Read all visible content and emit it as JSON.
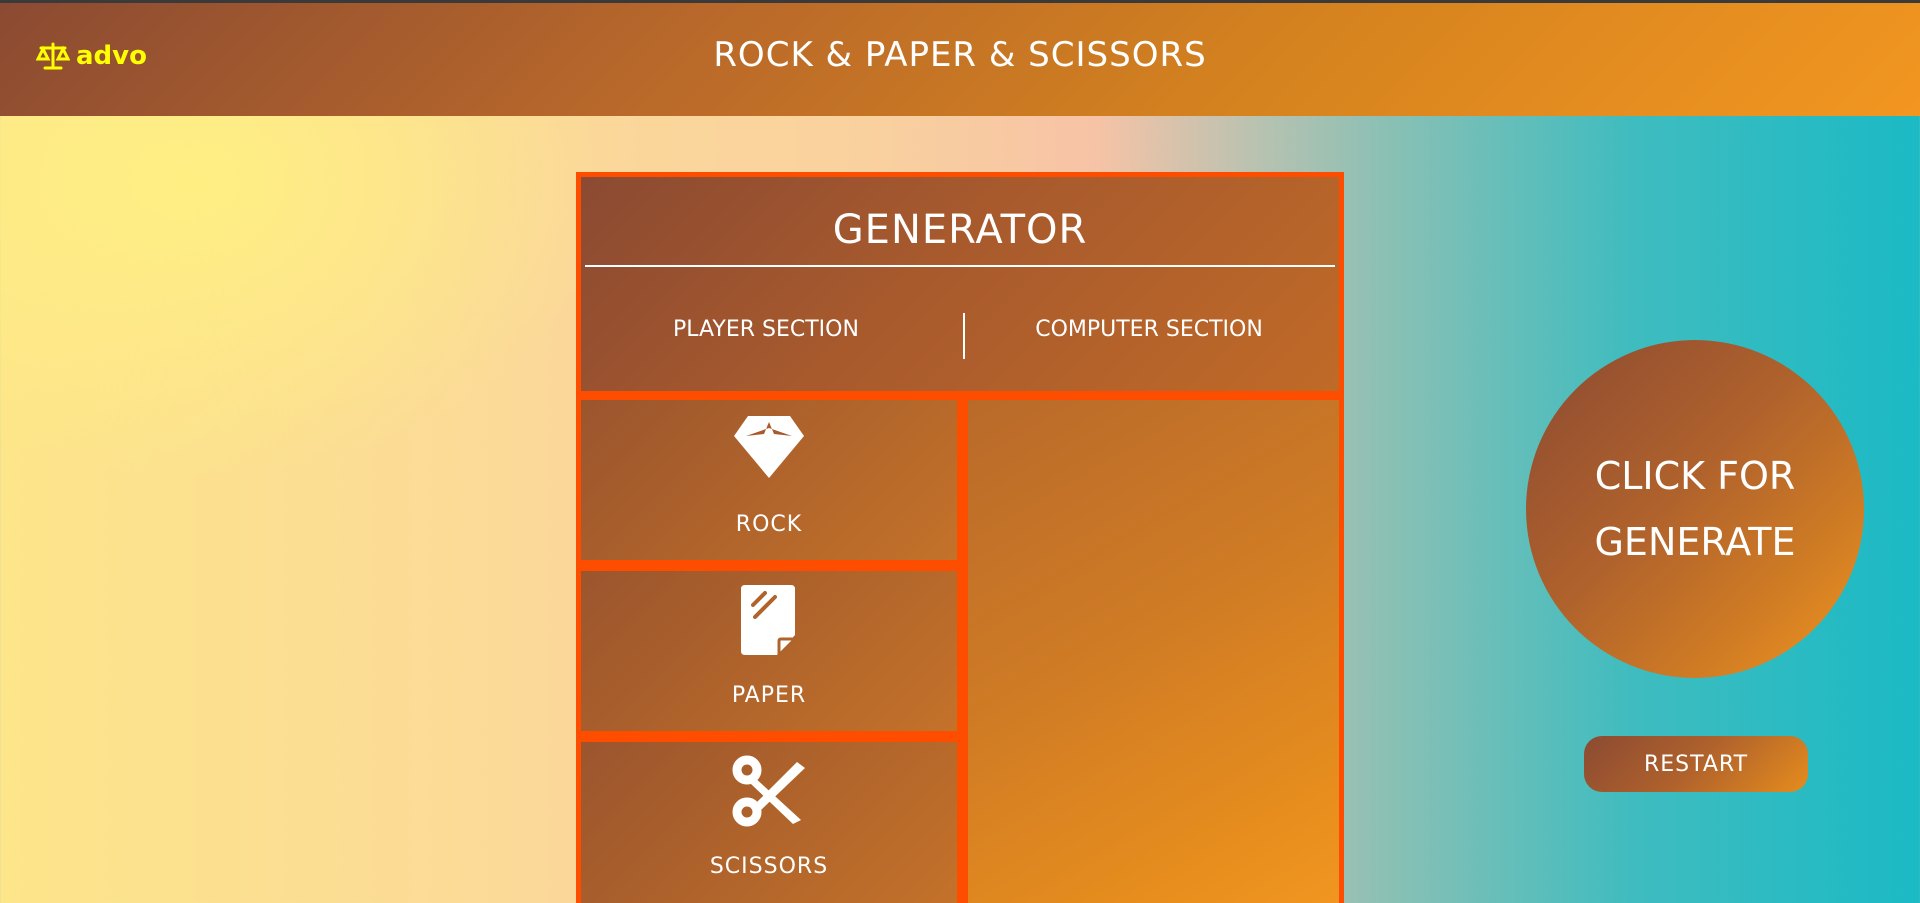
{
  "header": {
    "logo_text": "advo",
    "logo_icon": "scale-icon",
    "title": "ROCK & PAPER & SCISSORS"
  },
  "generator": {
    "title": "GENERATOR",
    "player_section_label": "PLAYER SECTION",
    "computer_section_label": "COMPUTER SECTION",
    "choices": [
      {
        "label": "ROCK",
        "icon": "gem-icon"
      },
      {
        "label": "PAPER",
        "icon": "paper-icon"
      },
      {
        "label": "SCISSORS",
        "icon": "scissors-icon"
      }
    ]
  },
  "controls": {
    "generate_line1": "CLICK FOR",
    "generate_line2": "GENERATE",
    "restart_label": "RESTART"
  },
  "colors": {
    "accent_border": "#ff4d00",
    "logo_color": "#ffff00",
    "gradient_start": "#8b4a32",
    "gradient_end": "#f29620"
  }
}
